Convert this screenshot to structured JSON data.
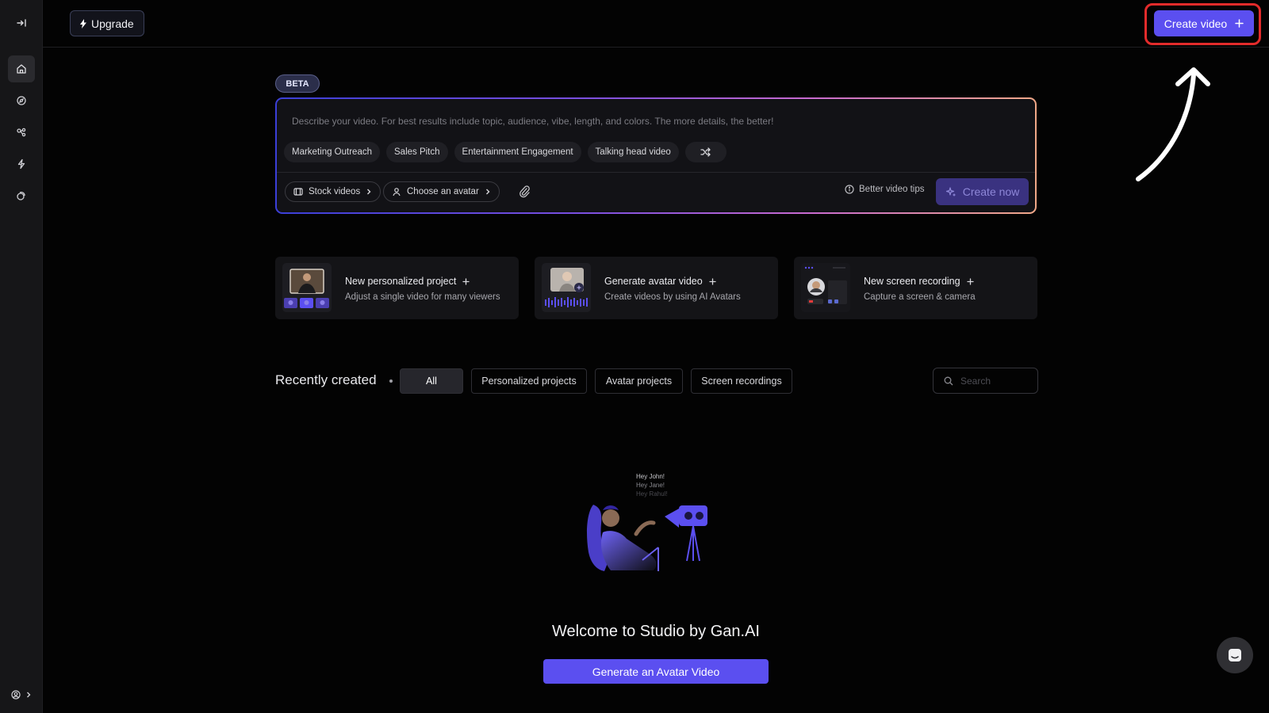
{
  "topbar": {
    "upgrade_label": "Upgrade",
    "create_video_label": "Create video"
  },
  "sidebar": {
    "items": [
      {
        "icon": "collapse-sidebar-icon"
      },
      {
        "icon": "home-icon",
        "active": true
      },
      {
        "icon": "compass-icon"
      },
      {
        "icon": "share-icon"
      },
      {
        "icon": "integrations-icon"
      },
      {
        "icon": "copy-icon"
      }
    ],
    "account_icon": "account-icon"
  },
  "prompt": {
    "badge": "BETA",
    "placeholder": "Describe your video. For best results include topic, audience, vibe, length, and colors. The more details, the better!",
    "suggestions": [
      "Marketing Outreach",
      "Sales Pitch",
      "Entertainment Engagement",
      "Talking head video"
    ],
    "stock_videos_label": "Stock videos",
    "choose_avatar_label": "Choose an avatar",
    "tips_label": "Better video tips",
    "create_now_label": "Create now"
  },
  "cards": [
    {
      "title": "New personalized project",
      "subtitle": "Adjust a single video for many viewers"
    },
    {
      "title": "Generate avatar video",
      "subtitle": "Create videos by using AI Avatars"
    },
    {
      "title": "New screen recording",
      "subtitle": "Capture a screen & camera"
    }
  ],
  "recent": {
    "title": "Recently created",
    "tabs": [
      "All",
      "Personalized projects",
      "Avatar projects",
      "Screen recordings"
    ],
    "active_tab": "All",
    "search_placeholder": "Search"
  },
  "empty_state": {
    "illustration_lines": [
      "Hey John!",
      "Hey Jane!",
      "Hey Rahul!"
    ],
    "welcome": "Welcome to Studio by Gan.AI",
    "cta_label": "Generate an Avatar Video"
  },
  "colors": {
    "accent": "#5b4ff0",
    "highlight": "#e32b2b",
    "background": "#030303"
  }
}
